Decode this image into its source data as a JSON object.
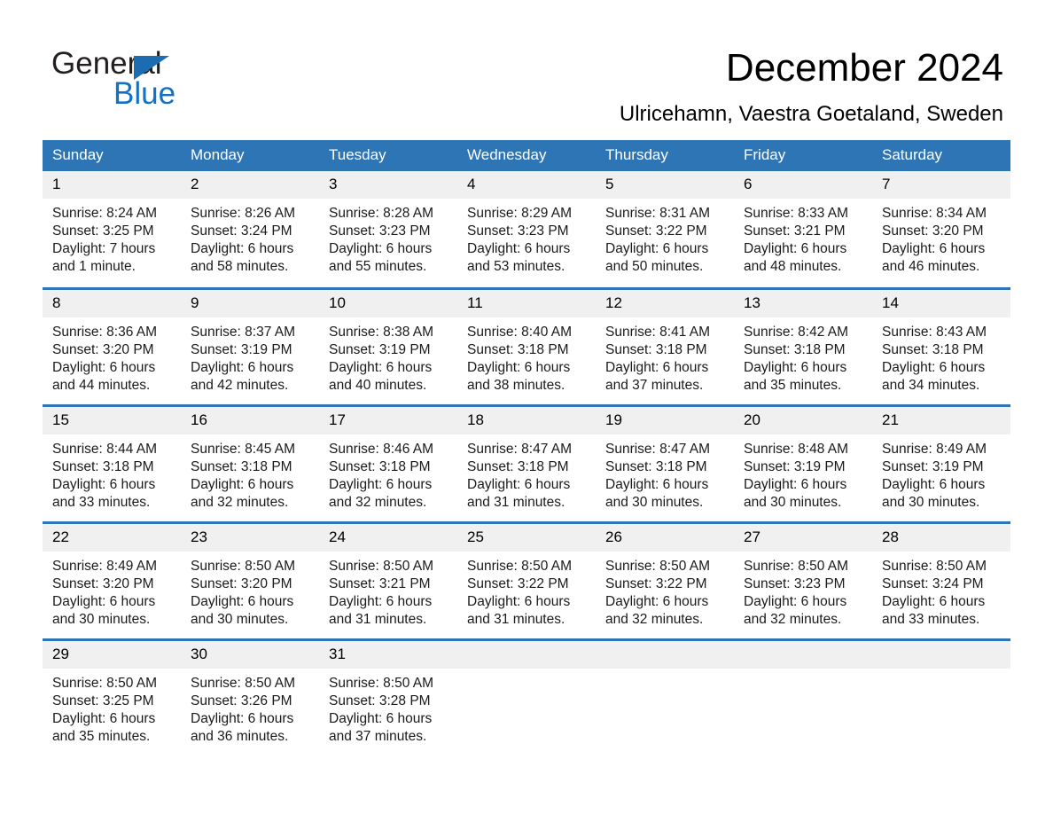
{
  "brand": {
    "name_part1": "General",
    "name_part2": "Blue",
    "logo_icon": "triangle-logo-icon",
    "accent_color": "#1271c4",
    "triangle_color": "#1b6cb0"
  },
  "header": {
    "title": "December 2024",
    "subtitle": "Ulricehamn, Vaestra Goetaland, Sweden"
  },
  "calendar": {
    "header_bg": "#2e75b6",
    "daynum_bg": "#f0f0f0",
    "weekdays": [
      "Sunday",
      "Monday",
      "Tuesday",
      "Wednesday",
      "Thursday",
      "Friday",
      "Saturday"
    ],
    "weeks": [
      [
        {
          "day": "1",
          "sunrise": "Sunrise: 8:24 AM",
          "sunset": "Sunset: 3:25 PM",
          "daylight_line1": "Daylight: 7 hours",
          "daylight_line2": "and 1 minute."
        },
        {
          "day": "2",
          "sunrise": "Sunrise: 8:26 AM",
          "sunset": "Sunset: 3:24 PM",
          "daylight_line1": "Daylight: 6 hours",
          "daylight_line2": "and 58 minutes."
        },
        {
          "day": "3",
          "sunrise": "Sunrise: 8:28 AM",
          "sunset": "Sunset: 3:23 PM",
          "daylight_line1": "Daylight: 6 hours",
          "daylight_line2": "and 55 minutes."
        },
        {
          "day": "4",
          "sunrise": "Sunrise: 8:29 AM",
          "sunset": "Sunset: 3:23 PM",
          "daylight_line1": "Daylight: 6 hours",
          "daylight_line2": "and 53 minutes."
        },
        {
          "day": "5",
          "sunrise": "Sunrise: 8:31 AM",
          "sunset": "Sunset: 3:22 PM",
          "daylight_line1": "Daylight: 6 hours",
          "daylight_line2": "and 50 minutes."
        },
        {
          "day": "6",
          "sunrise": "Sunrise: 8:33 AM",
          "sunset": "Sunset: 3:21 PM",
          "daylight_line1": "Daylight: 6 hours",
          "daylight_line2": "and 48 minutes."
        },
        {
          "day": "7",
          "sunrise": "Sunrise: 8:34 AM",
          "sunset": "Sunset: 3:20 PM",
          "daylight_line1": "Daylight: 6 hours",
          "daylight_line2": "and 46 minutes."
        }
      ],
      [
        {
          "day": "8",
          "sunrise": "Sunrise: 8:36 AM",
          "sunset": "Sunset: 3:20 PM",
          "daylight_line1": "Daylight: 6 hours",
          "daylight_line2": "and 44 minutes."
        },
        {
          "day": "9",
          "sunrise": "Sunrise: 8:37 AM",
          "sunset": "Sunset: 3:19 PM",
          "daylight_line1": "Daylight: 6 hours",
          "daylight_line2": "and 42 minutes."
        },
        {
          "day": "10",
          "sunrise": "Sunrise: 8:38 AM",
          "sunset": "Sunset: 3:19 PM",
          "daylight_line1": "Daylight: 6 hours",
          "daylight_line2": "and 40 minutes."
        },
        {
          "day": "11",
          "sunrise": "Sunrise: 8:40 AM",
          "sunset": "Sunset: 3:18 PM",
          "daylight_line1": "Daylight: 6 hours",
          "daylight_line2": "and 38 minutes."
        },
        {
          "day": "12",
          "sunrise": "Sunrise: 8:41 AM",
          "sunset": "Sunset: 3:18 PM",
          "daylight_line1": "Daylight: 6 hours",
          "daylight_line2": "and 37 minutes."
        },
        {
          "day": "13",
          "sunrise": "Sunrise: 8:42 AM",
          "sunset": "Sunset: 3:18 PM",
          "daylight_line1": "Daylight: 6 hours",
          "daylight_line2": "and 35 minutes."
        },
        {
          "day": "14",
          "sunrise": "Sunrise: 8:43 AM",
          "sunset": "Sunset: 3:18 PM",
          "daylight_line1": "Daylight: 6 hours",
          "daylight_line2": "and 34 minutes."
        }
      ],
      [
        {
          "day": "15",
          "sunrise": "Sunrise: 8:44 AM",
          "sunset": "Sunset: 3:18 PM",
          "daylight_line1": "Daylight: 6 hours",
          "daylight_line2": "and 33 minutes."
        },
        {
          "day": "16",
          "sunrise": "Sunrise: 8:45 AM",
          "sunset": "Sunset: 3:18 PM",
          "daylight_line1": "Daylight: 6 hours",
          "daylight_line2": "and 32 minutes."
        },
        {
          "day": "17",
          "sunrise": "Sunrise: 8:46 AM",
          "sunset": "Sunset: 3:18 PM",
          "daylight_line1": "Daylight: 6 hours",
          "daylight_line2": "and 32 minutes."
        },
        {
          "day": "18",
          "sunrise": "Sunrise: 8:47 AM",
          "sunset": "Sunset: 3:18 PM",
          "daylight_line1": "Daylight: 6 hours",
          "daylight_line2": "and 31 minutes."
        },
        {
          "day": "19",
          "sunrise": "Sunrise: 8:47 AM",
          "sunset": "Sunset: 3:18 PM",
          "daylight_line1": "Daylight: 6 hours",
          "daylight_line2": "and 30 minutes."
        },
        {
          "day": "20",
          "sunrise": "Sunrise: 8:48 AM",
          "sunset": "Sunset: 3:19 PM",
          "daylight_line1": "Daylight: 6 hours",
          "daylight_line2": "and 30 minutes."
        },
        {
          "day": "21",
          "sunrise": "Sunrise: 8:49 AM",
          "sunset": "Sunset: 3:19 PM",
          "daylight_line1": "Daylight: 6 hours",
          "daylight_line2": "and 30 minutes."
        }
      ],
      [
        {
          "day": "22",
          "sunrise": "Sunrise: 8:49 AM",
          "sunset": "Sunset: 3:20 PM",
          "daylight_line1": "Daylight: 6 hours",
          "daylight_line2": "and 30 minutes."
        },
        {
          "day": "23",
          "sunrise": "Sunrise: 8:50 AM",
          "sunset": "Sunset: 3:20 PM",
          "daylight_line1": "Daylight: 6 hours",
          "daylight_line2": "and 30 minutes."
        },
        {
          "day": "24",
          "sunrise": "Sunrise: 8:50 AM",
          "sunset": "Sunset: 3:21 PM",
          "daylight_line1": "Daylight: 6 hours",
          "daylight_line2": "and 31 minutes."
        },
        {
          "day": "25",
          "sunrise": "Sunrise: 8:50 AM",
          "sunset": "Sunset: 3:22 PM",
          "daylight_line1": "Daylight: 6 hours",
          "daylight_line2": "and 31 minutes."
        },
        {
          "day": "26",
          "sunrise": "Sunrise: 8:50 AM",
          "sunset": "Sunset: 3:22 PM",
          "daylight_line1": "Daylight: 6 hours",
          "daylight_line2": "and 32 minutes."
        },
        {
          "day": "27",
          "sunrise": "Sunrise: 8:50 AM",
          "sunset": "Sunset: 3:23 PM",
          "daylight_line1": "Daylight: 6 hours",
          "daylight_line2": "and 32 minutes."
        },
        {
          "day": "28",
          "sunrise": "Sunrise: 8:50 AM",
          "sunset": "Sunset: 3:24 PM",
          "daylight_line1": "Daylight: 6 hours",
          "daylight_line2": "and 33 minutes."
        }
      ],
      [
        {
          "day": "29",
          "sunrise": "Sunrise: 8:50 AM",
          "sunset": "Sunset: 3:25 PM",
          "daylight_line1": "Daylight: 6 hours",
          "daylight_line2": "and 35 minutes."
        },
        {
          "day": "30",
          "sunrise": "Sunrise: 8:50 AM",
          "sunset": "Sunset: 3:26 PM",
          "daylight_line1": "Daylight: 6 hours",
          "daylight_line2": "and 36 minutes."
        },
        {
          "day": "31",
          "sunrise": "Sunrise: 8:50 AM",
          "sunset": "Sunset: 3:28 PM",
          "daylight_line1": "Daylight: 6 hours",
          "daylight_line2": "and 37 minutes."
        },
        {
          "day": "",
          "sunrise": "",
          "sunset": "",
          "daylight_line1": "",
          "daylight_line2": ""
        },
        {
          "day": "",
          "sunrise": "",
          "sunset": "",
          "daylight_line1": "",
          "daylight_line2": ""
        },
        {
          "day": "",
          "sunrise": "",
          "sunset": "",
          "daylight_line1": "",
          "daylight_line2": ""
        },
        {
          "day": "",
          "sunrise": "",
          "sunset": "",
          "daylight_line1": "",
          "daylight_line2": ""
        }
      ]
    ]
  }
}
